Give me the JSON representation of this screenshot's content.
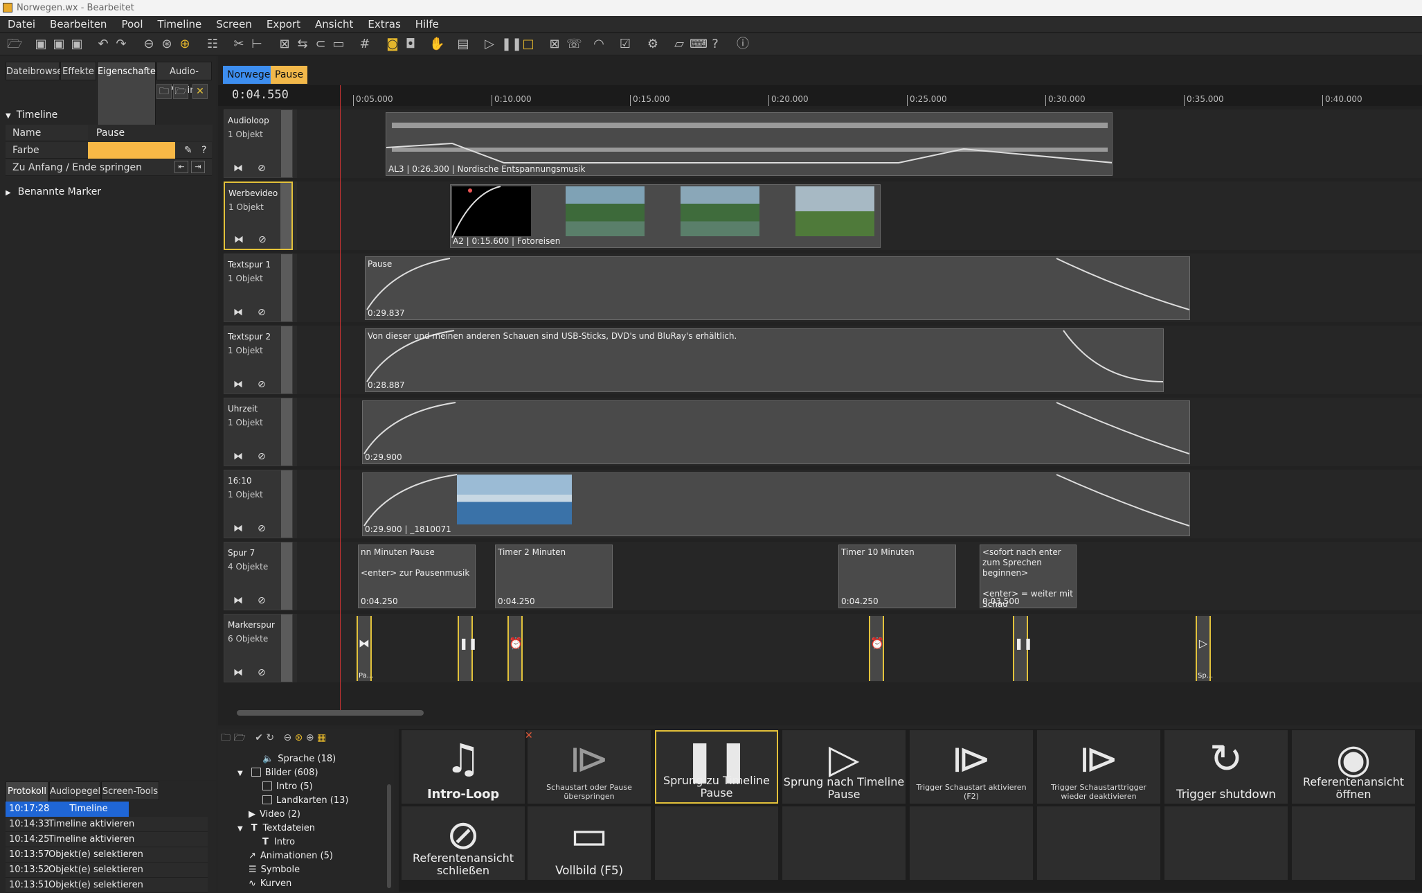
{
  "window": {
    "title": "Norwegen.wx - Bearbeitet"
  },
  "menu": [
    "Datei",
    "Bearbeiten",
    "Pool",
    "Timeline",
    "Screen",
    "Export",
    "Ansicht",
    "Extras",
    "Hilfe"
  ],
  "left_tabs": [
    "Dateibrowser",
    "Effekte",
    "Eigenschaften",
    "Audio-Plugins"
  ],
  "properties": {
    "section": "Timeline",
    "rows": [
      {
        "key": "Name",
        "value": "Pause"
      },
      {
        "key": "Farbe",
        "value": ""
      },
      {
        "key": "Zu Anfang / Ende springen",
        "value": ""
      }
    ],
    "color": "#f8b846",
    "named_markers": "Benannte Marker"
  },
  "timeline": {
    "tabs": [
      {
        "label": "Norwegen",
        "color": "#3d8ef0"
      },
      {
        "label": "Pause",
        "color": "#f2b84a"
      }
    ],
    "time": "0:04.550",
    "ticks": [
      "0:05.000",
      "0:10.000",
      "0:15.000",
      "0:20.000",
      "0:25.000",
      "0:30.000",
      "0:35.000",
      "0:40.000"
    ],
    "tracks": [
      {
        "name": "Audioloop",
        "count": "1 Objekt",
        "clips": [
          {
            "label": "AL3 | 0:26.300 | Nordische Entspannungsmusik"
          }
        ]
      },
      {
        "name": "Werbevideo",
        "count": "1 Objekt",
        "clips": [
          {
            "label": "A2 | 0:15.600 | Fotoreisen"
          }
        ]
      },
      {
        "name": "Textspur 1",
        "count": "1 Objekt",
        "clips": [
          {
            "top": "Pause",
            "label": "0:29.837"
          }
        ]
      },
      {
        "name": "Textspur 2",
        "count": "1 Objekt",
        "clips": [
          {
            "top": "Von dieser und meinen anderen Schauen sind USB-Sticks, DVD's und BluRay's erhältlich.",
            "label": "0:28.887"
          }
        ]
      },
      {
        "name": "Uhrzeit",
        "count": "1 Objekt",
        "clips": [
          {
            "label": "0:29.900"
          }
        ]
      },
      {
        "name": "16:10",
        "count": "1 Objekt",
        "clips": [
          {
            "label": "0:29.900 | _1810071"
          }
        ]
      },
      {
        "name": "Spur 7",
        "count": "4 Objekte",
        "clips": [
          {
            "top": "nn Minuten Pause\n\n<enter> zur Pausenmusik",
            "label": "0:04.250"
          },
          {
            "top": "Timer 2 Minuten",
            "label": "0:04.250"
          },
          {
            "top": "Timer 10 Minuten",
            "label": "0:04.250"
          },
          {
            "top": "<sofort nach enter zum Sprechen beginnen>\n\n<enter> = weiter mit Schau",
            "label": "0:03.500"
          }
        ]
      },
      {
        "name": "Markerspur",
        "count": "6 Objekte",
        "markers": [
          {
            "label": "Pa..."
          },
          {
            "label": ""
          },
          {
            "label": ""
          },
          {
            "label": ""
          },
          {
            "label": ""
          },
          {
            "label": "Sp..."
          }
        ]
      }
    ]
  },
  "tree": [
    {
      "label": "Sprache (18)"
    },
    {
      "label": "Bilder (608)"
    },
    {
      "label": "Intro (5)"
    },
    {
      "label": "Landkarten (13)"
    },
    {
      "label": "Video (2)"
    },
    {
      "label": "Textdateien"
    },
    {
      "label": "Intro"
    },
    {
      "label": "Animationen (5)"
    },
    {
      "label": "Symbole"
    },
    {
      "label": "Kurven"
    }
  ],
  "bottom_tabs": [
    "Protokoll",
    "Audiopegel",
    "Screen-Tools"
  ],
  "log": [
    {
      "time": "10:17:28",
      "msg": "Timeline aktivieren"
    },
    {
      "time": "10:14:33",
      "msg": "Timeline aktivieren"
    },
    {
      "time": "10:14:25",
      "msg": "Timeline aktivieren"
    },
    {
      "time": "10:13:57",
      "msg": "Objekt(e) selektieren"
    },
    {
      "time": "10:13:52",
      "msg": "Objekt(e) selektieren"
    },
    {
      "time": "10:13:51",
      "msg": "Objekt(e) selektieren"
    }
  ],
  "actions": [
    {
      "label": "Intro-Loop",
      "icon": "music-list-icon"
    },
    {
      "label": "Schaustart oder Pause überspringen",
      "icon": "play-box-icon"
    },
    {
      "label": "Sprung zu Timeline Pause",
      "icon": "pause-icon"
    },
    {
      "label": "Sprung nach Timeline Pause",
      "icon": "play-icon"
    },
    {
      "label": "Trigger Schaustart aktivieren (F2)",
      "icon": "play-box-icon"
    },
    {
      "label": "Trigger Schaustarttrigger wieder deaktivieren",
      "icon": "play-box-icon"
    },
    {
      "label": "Trigger shutdown",
      "icon": "restart-icon"
    },
    {
      "label": "Referentenansicht öffnen",
      "icon": "eye-icon"
    },
    {
      "label": "Referentenansicht schließen",
      "icon": "eye-off-icon"
    },
    {
      "label": "Vollbild (F5)",
      "icon": "laptop-icon"
    }
  ]
}
